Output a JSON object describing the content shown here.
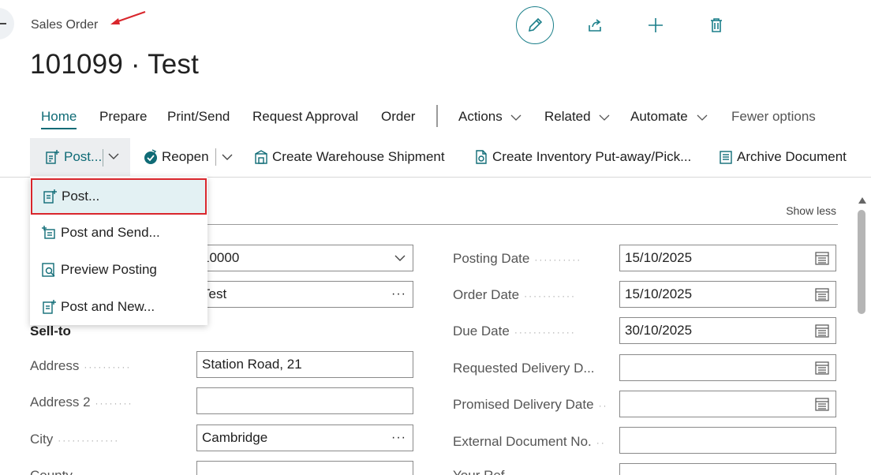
{
  "page": {
    "caption": "Sales Order",
    "title": "101099 · Test"
  },
  "top_actions": [
    {
      "name": "edit",
      "icon": "pencil-icon"
    },
    {
      "name": "share",
      "icon": "share-icon"
    },
    {
      "name": "new",
      "icon": "plus-icon"
    },
    {
      "name": "delete",
      "icon": "trash-icon"
    }
  ],
  "tabs": {
    "home": "Home",
    "prepare": "Prepare",
    "print_send": "Print/Send",
    "request_approval": "Request Approval",
    "order": "Order",
    "actions": "Actions",
    "related": "Related",
    "automate": "Automate",
    "fewer_options": "Fewer options"
  },
  "actionbar": {
    "post": "Post...",
    "reopen": "Reopen",
    "create_warehouse_shipment": "Create Warehouse Shipment",
    "create_inventory": "Create Inventory Put-away/Pick...",
    "archive_document": "Archive Document"
  },
  "post_menu": {
    "post": "Post...",
    "post_and_send": "Post and Send...",
    "preview_posting": "Preview Posting",
    "post_and_new": "Post and New..."
  },
  "section": {
    "show_less": "Show less",
    "sell_to": "Sell-to"
  },
  "fields_left": {
    "customer_no_value": "10000",
    "customer_name_value": "Test",
    "address_label": "Address",
    "address_value": "Station Road, 21",
    "address2_label": "Address 2",
    "address2_value": "",
    "city_label": "City",
    "city_value": "Cambridge",
    "county_label": "County"
  },
  "fields_right": {
    "posting_date_label": "Posting Date",
    "posting_date_value": "15/10/2025",
    "order_date_label": "Order Date",
    "order_date_value": "15/10/2025",
    "due_date_label": "Due Date",
    "due_date_value": "30/10/2025",
    "requested_delivery_label": "Requested Delivery D...",
    "requested_delivery_value": "",
    "promised_delivery_label": "Promised Delivery Date",
    "promised_delivery_value": "",
    "external_doc_label": "External Document No.",
    "external_doc_value": "",
    "your_ref_label": "Your Ref"
  },
  "colors": {
    "accent": "#0f6b76",
    "highlight_border": "#d9262c",
    "annotation_arrow": "#d9262c"
  }
}
